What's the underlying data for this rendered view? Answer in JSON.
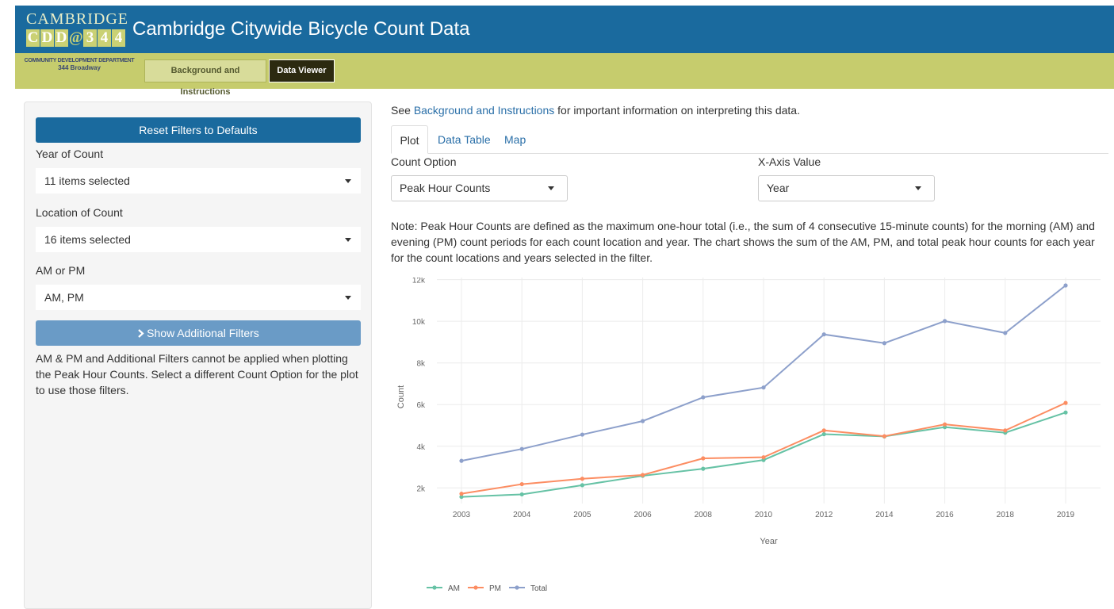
{
  "header": {
    "logo_top": "CAMBRIDGE",
    "logo_letters": [
      "C",
      "D",
      "D",
      "@",
      "3",
      "4",
      "4"
    ],
    "title": "Cambridge Citywide Bicycle Count Data"
  },
  "subnav": {
    "dept_line1": "COMMUNITY DEVELOPMENT DEPARTMENT",
    "dept_line2": "344 Broadway",
    "tab_background": "Background and Instructions",
    "tab_viewer": "Data Viewer"
  },
  "sidebar": {
    "reset_button": "Reset Filters to Defaults",
    "year_label": "Year of Count",
    "year_value": "11 items selected",
    "location_label": "Location of Count",
    "location_value": "16 items selected",
    "ampm_label": "AM or PM",
    "ampm_value": "AM, PM",
    "more_button_icon": "chevron-right-icon",
    "more_button": "Show Additional Filters",
    "note": "AM & PM and Additional Filters cannot be applied when plotting the Peak Hour Counts. Select a different Count Option for the plot to use those filters."
  },
  "main": {
    "intro_prefix": "See ",
    "intro_link": "Background and Instructions",
    "intro_suffix": " for important information on interpreting this data.",
    "tabs": [
      "Plot",
      "Data Table",
      "Map"
    ],
    "count_option_label": "Count Option",
    "count_option_value": "Peak Hour Counts",
    "xaxis_label": "X-Axis Value",
    "xaxis_value": "Year",
    "note": "Note: Peak Hour Counts are defined as the maximum one-hour total (i.e., the sum of 4 consecutive 15-minute counts) for the morning (AM) and evening (PM) count periods for each count location and year. The chart shows the sum of the AM, PM, and total peak hour counts for each year for the count locations and years selected in the filter."
  },
  "chart_data": {
    "type": "line",
    "categories": [
      "2003",
      "2004",
      "2005",
      "2006",
      "2008",
      "2010",
      "2012",
      "2014",
      "2016",
      "2018",
      "2019"
    ],
    "series": [
      {
        "name": "AM",
        "color": "#66c2a5",
        "values": [
          1570,
          1690,
          2130,
          2580,
          2920,
          3340,
          4580,
          4470,
          4920,
          4650,
          5620
        ]
      },
      {
        "name": "PM",
        "color": "#fc8d62",
        "values": [
          1720,
          2180,
          2440,
          2620,
          3420,
          3470,
          4760,
          4480,
          5050,
          4760,
          6080
        ]
      },
      {
        "name": "Total",
        "color": "#8da0cb",
        "values": [
          3300,
          3870,
          4560,
          5210,
          6350,
          6820,
          9370,
          8950,
          10010,
          9440,
          11720
        ]
      }
    ],
    "yticks": [
      "2k",
      "4k",
      "6k",
      "8k",
      "10k",
      "12k"
    ],
    "ytick_values": [
      2000,
      4000,
      6000,
      8000,
      10000,
      12000
    ],
    "ylim": [
      1250,
      12100
    ],
    "xlabel": "Year",
    "ylabel": "Count",
    "grid": true,
    "legend_position": "bottom-left"
  }
}
